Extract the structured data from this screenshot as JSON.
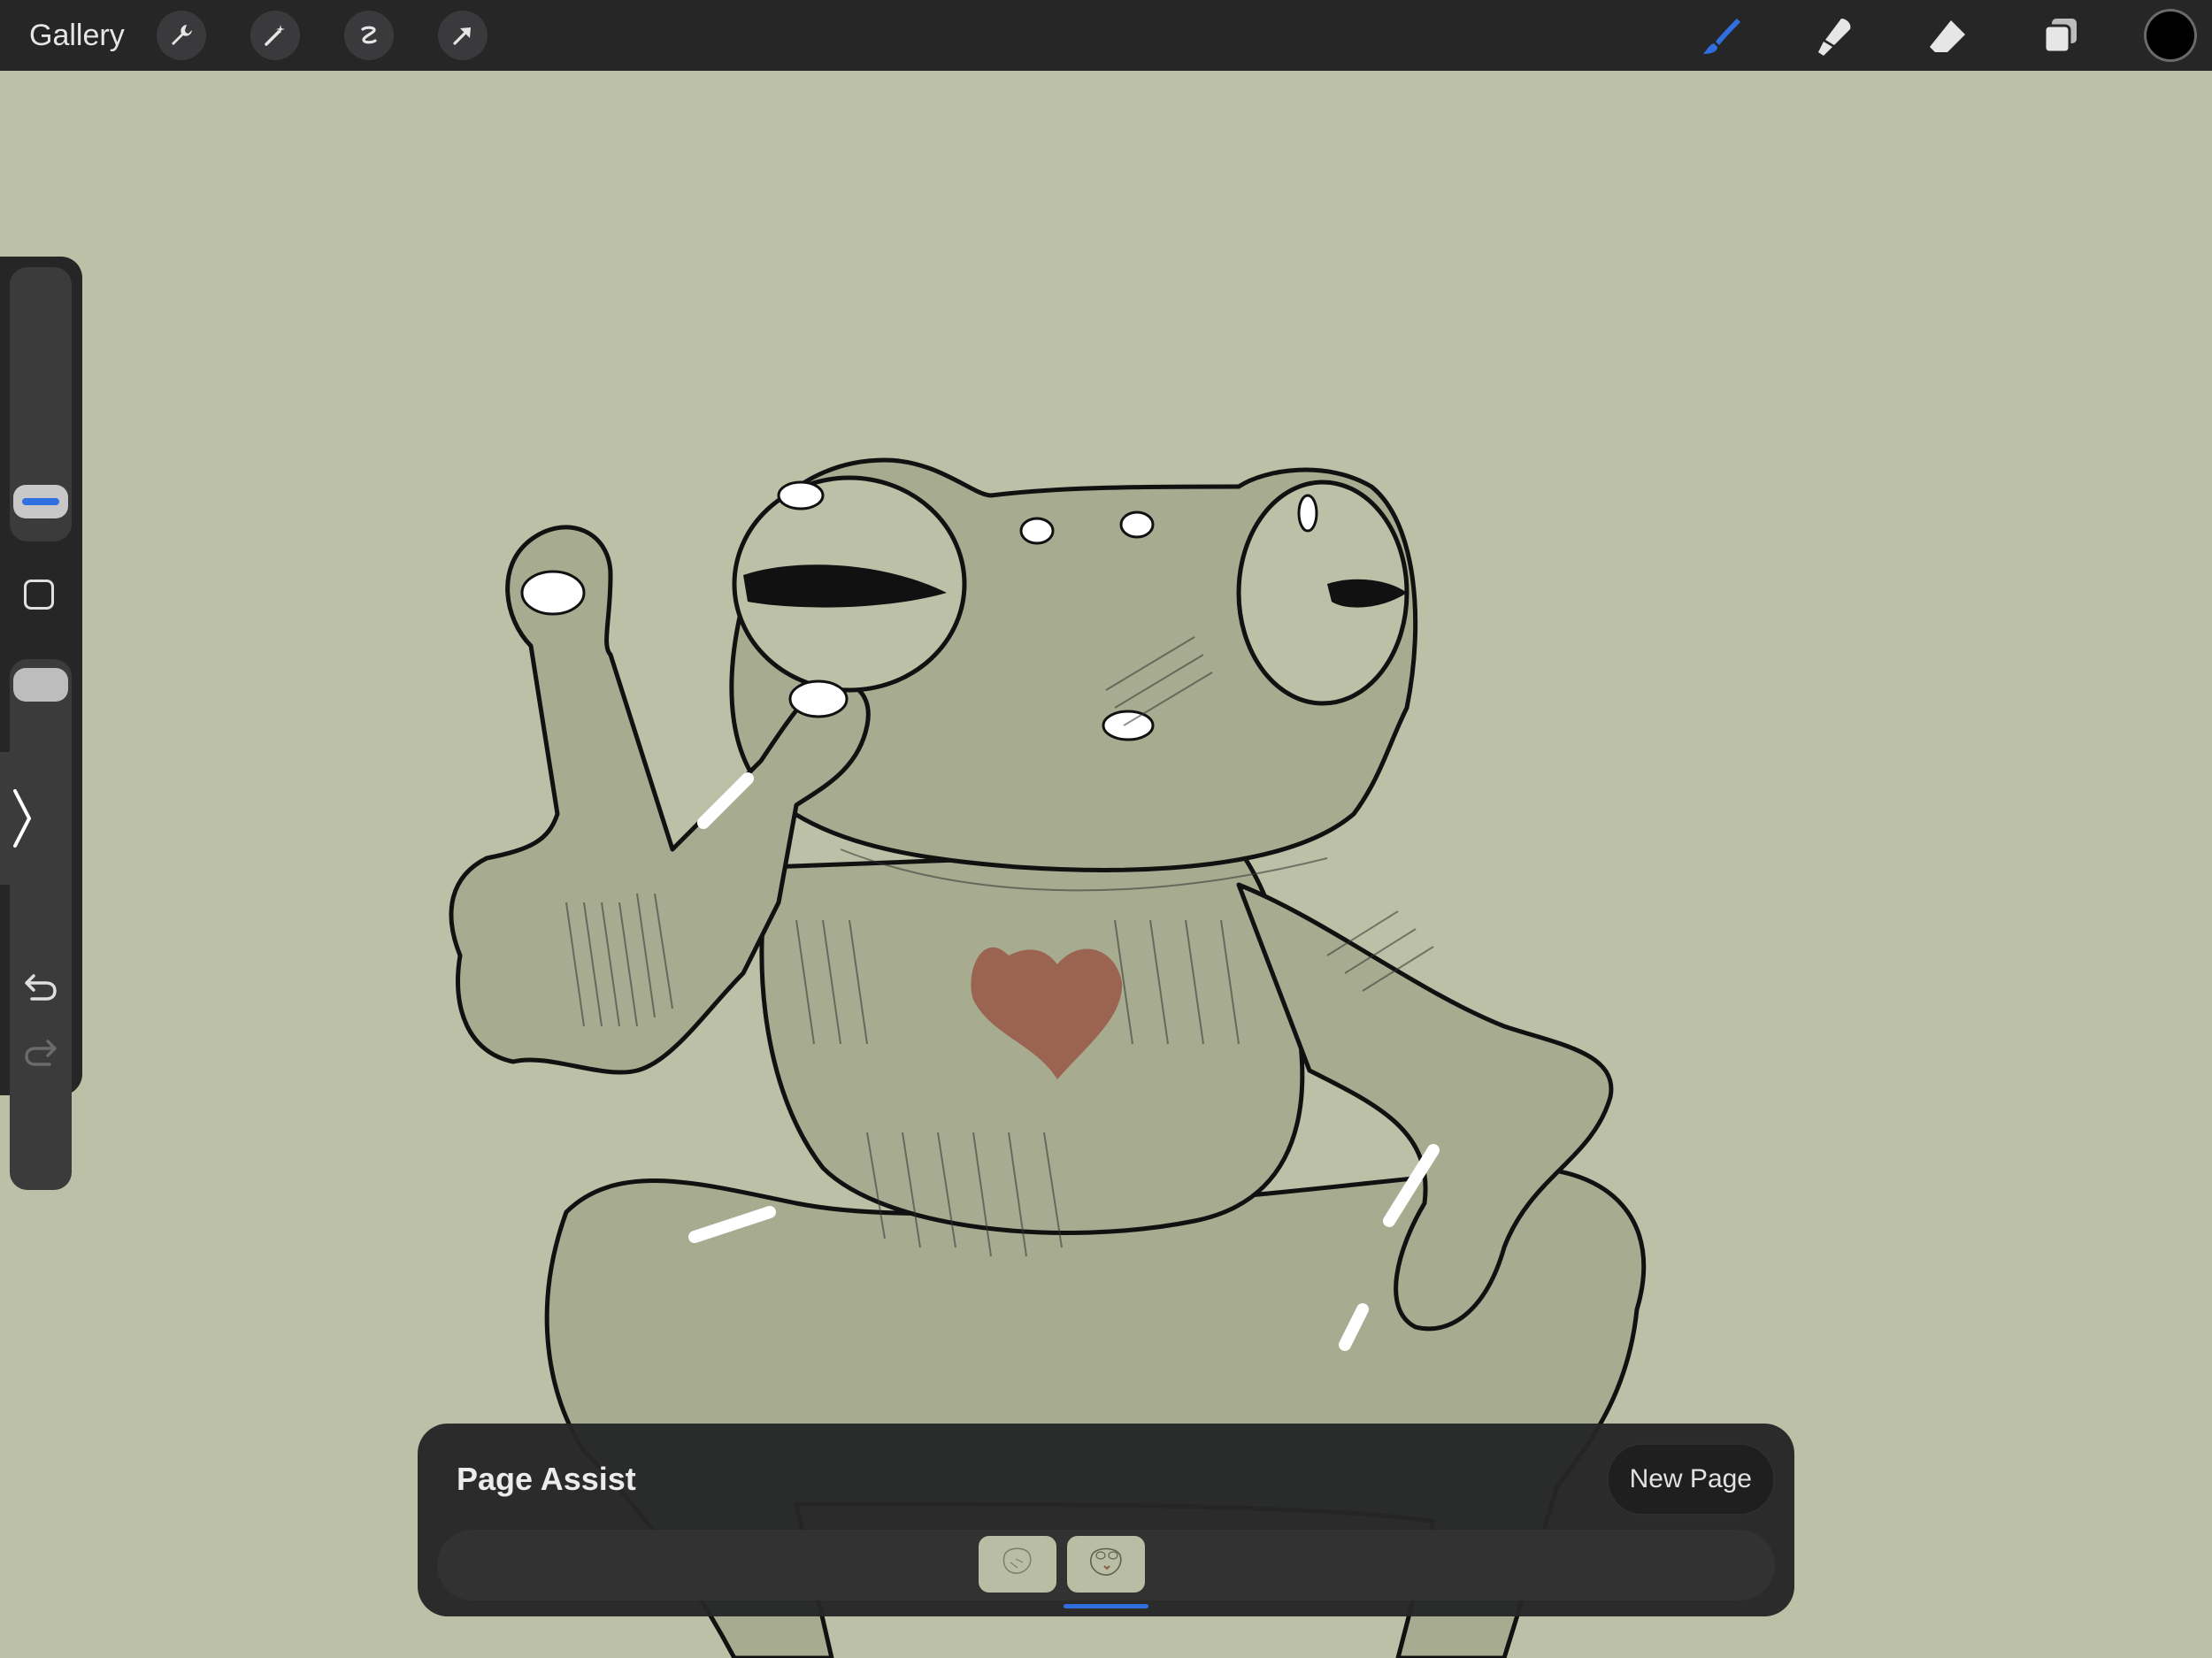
{
  "topbar": {
    "gallery_label": "Gallery",
    "left_tools": [
      "wrench-icon",
      "magic-wand-icon",
      "selection-icon",
      "transform-arrow-icon"
    ],
    "right_tools": [
      "brush-icon",
      "smudge-icon",
      "eraser-icon",
      "layers-icon"
    ],
    "active_tool": "brush-icon",
    "current_color": "#000000",
    "accent": "#2f6fe0"
  },
  "sidebar": {
    "brush_size_level": 0.2,
    "opacity_level": 0.85,
    "tools": [
      "modify-square-icon",
      "sidebar-toggle-chevron",
      "undo-icon",
      "redo-icon"
    ]
  },
  "page_assist": {
    "title": "Page Assist",
    "new_page_label": "New Page",
    "pages": [
      "page-1",
      "page-2"
    ],
    "selected_page": 2
  },
  "canvas": {
    "background_color": "#bcc0a6",
    "subject": "frog-sketch",
    "heart_color": "#9b6451"
  }
}
